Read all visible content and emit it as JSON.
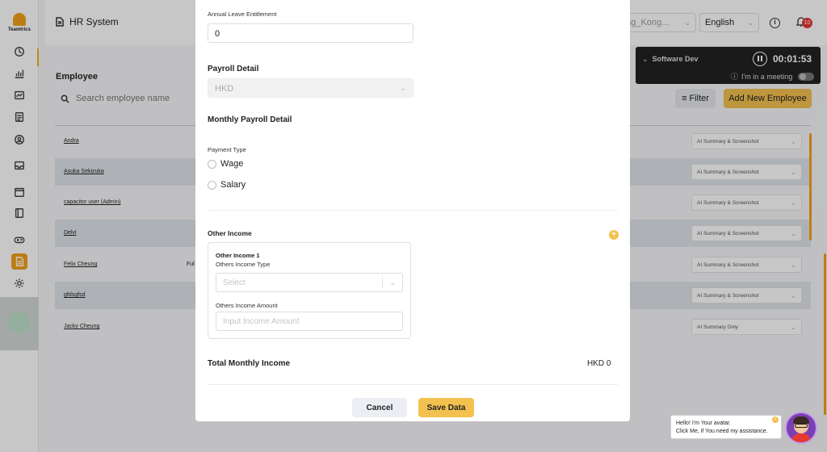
{
  "sidebar": {
    "logo_text": "Teamtrics",
    "icons": [
      "history-icon",
      "dashboard-icon",
      "chart-icon",
      "report-icon",
      "user-icon",
      "inbox-icon",
      "calendar-icon",
      "book-icon",
      "gamepad-icon",
      "document-icon",
      "settings-icon"
    ],
    "active_icon": "document-icon",
    "accent_color": "#f3a11a"
  },
  "header": {
    "title": "HR System",
    "timezone": "ong_Kong...",
    "language": "English",
    "notification_count": "10"
  },
  "employee_page": {
    "section_title": "Employee",
    "search_placeholder": "Search employee name",
    "filter_label": "Filter",
    "add_button": "Add New Employee",
    "rows": [
      {
        "name": "Andra",
        "extra": "",
        "mode": "AI Summary & Screenshot"
      },
      {
        "name": "Asuka Sekizuka",
        "extra": "",
        "mode": "AI Summary & Screenshot"
      },
      {
        "name": "capacitor user (Admin)",
        "extra": "",
        "mode": "AI Summary & Screenshot"
      },
      {
        "name": "Delvi",
        "extra": "",
        "mode": "AI Summary & Screenshot"
      },
      {
        "name": "Felix Cheung",
        "extra": "Ful",
        "mode": "AI Summary & Screenshot"
      },
      {
        "name": "gfdsgfsd",
        "extra": "",
        "mode": "AI Summary & Screenshot"
      },
      {
        "name": "Jacky Cheung",
        "extra": "",
        "mode": "AI Summary Only"
      }
    ]
  },
  "timer": {
    "team": "Software Dev",
    "time": "00:01:53",
    "meeting_label": "I'm in a meeting"
  },
  "modal": {
    "annual_leave_label": "Annual Leave Entitlement",
    "annual_leave_value": "0",
    "payroll_detail_title": "Payroll Detail",
    "currency": "HKD",
    "monthly_payroll_title": "Monthly Payroll Detail",
    "payment_type_label": "Payment Type",
    "payment_types": [
      "Wage",
      "Salary"
    ],
    "other_income_title": "Other Income",
    "other_income_item_title": "Other Income 1",
    "others_income_type_label": "Others Income Type",
    "others_income_type_placeholder": "Select",
    "others_income_amount_label": "Others Income Amount",
    "others_income_amount_placeholder": "Input Income Amount",
    "total_monthly_income_label": "Total Monthly Income",
    "total_monthly_income_value": "HKD 0",
    "cancel_label": "Cancel",
    "save_label": "Save Data"
  },
  "assistant": {
    "line1": "Hello! I'm Your avatar.",
    "line2": "Click Me, if You need my assistance."
  }
}
